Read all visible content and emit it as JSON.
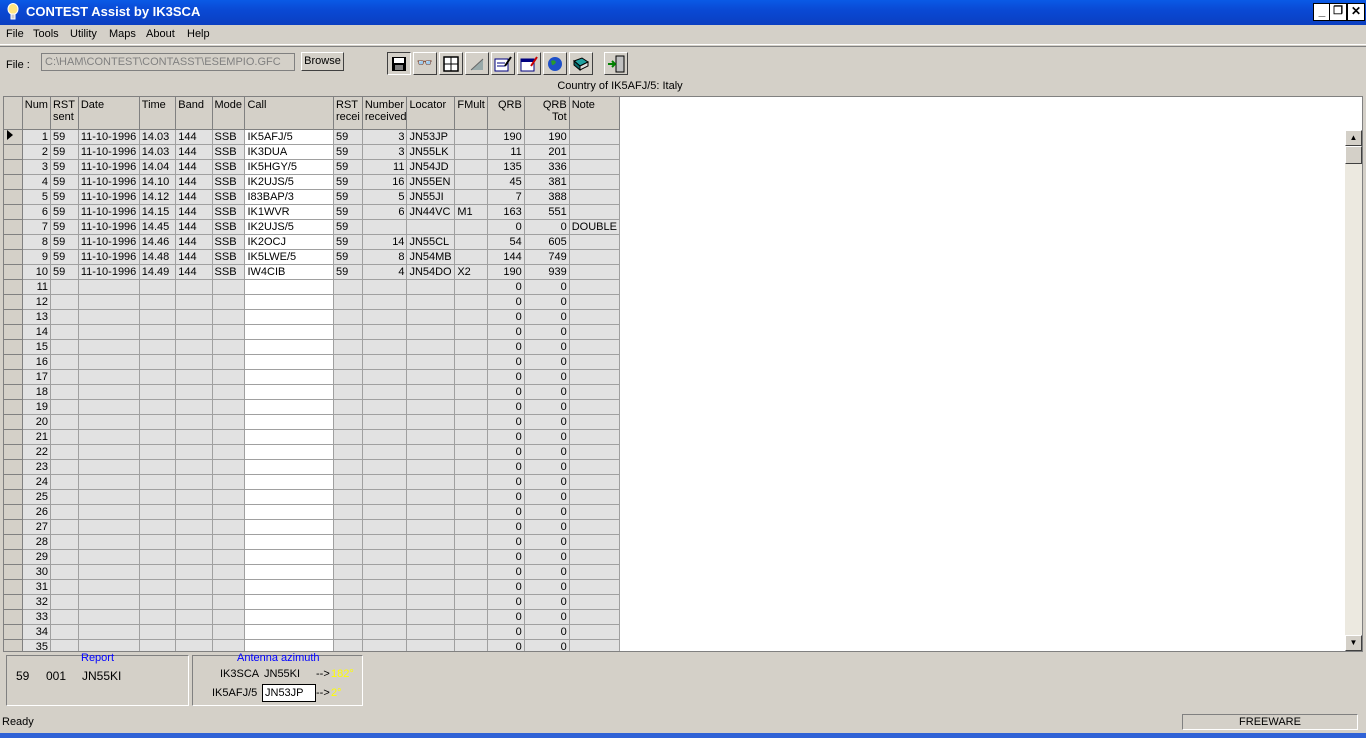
{
  "app": {
    "title": "CONTEST Assist by IK3SCA"
  },
  "menu": [
    "File",
    "Tools",
    "Utility",
    "Maps",
    "About",
    "Help"
  ],
  "toolbar": {
    "file_label": "File :",
    "file_path": "C:\\HAM\\CONTEST\\CONTASST\\ESEMPIO.GFC",
    "browse_label": "Browse",
    "icons": [
      "save-icon",
      "binoculars-icon",
      "grid-icon",
      "chart-icon",
      "edit-list-icon",
      "calendar-icon",
      "globe-icon",
      "book-icon",
      "exit-icon"
    ]
  },
  "country_text": "Country of IK5AFJ/5: Italy",
  "table": {
    "headers": [
      "Num",
      "RST sent",
      "Date",
      "Time",
      "Band",
      "Mode",
      "Call",
      "RST recei",
      "Number received",
      "Locator",
      "FMult",
      "QRB",
      "QRB Tot",
      "Note"
    ],
    "rows": [
      [
        "1",
        "59",
        "11-10-1996",
        "14.03",
        "144",
        "SSB",
        "IK5AFJ/5",
        "59",
        "3",
        "JN53JP",
        "",
        "190",
        "190",
        ""
      ],
      [
        "2",
        "59",
        "11-10-1996",
        "14.03",
        "144",
        "SSB",
        "IK3DUA",
        "59",
        "3",
        "JN55LK",
        "",
        "11",
        "201",
        ""
      ],
      [
        "3",
        "59",
        "11-10-1996",
        "14.04",
        "144",
        "SSB",
        "IK5HGY/5",
        "59",
        "11",
        "JN54JD",
        "",
        "135",
        "336",
        ""
      ],
      [
        "4",
        "59",
        "11-10-1996",
        "14.10",
        "144",
        "SSB",
        "IK2UJS/5",
        "59",
        "16",
        "JN55EN",
        "",
        "45",
        "381",
        ""
      ],
      [
        "5",
        "59",
        "11-10-1996",
        "14.12",
        "144",
        "SSB",
        "I83BAP/3",
        "59",
        "5",
        "JN55JI",
        "",
        "7",
        "388",
        ""
      ],
      [
        "6",
        "59",
        "11-10-1996",
        "14.15",
        "144",
        "SSB",
        "IK1WVR",
        "59",
        "6",
        "JN44VC",
        "M1",
        "163",
        "551",
        ""
      ],
      [
        "7",
        "59",
        "11-10-1996",
        "14.45",
        "144",
        "SSB",
        "IK2UJS/5",
        "59",
        "",
        "",
        "",
        "0",
        "0",
        "DOUBLE"
      ],
      [
        "8",
        "59",
        "11-10-1996",
        "14.46",
        "144",
        "SSB",
        "IK2OCJ",
        "59",
        "14",
        "JN55CL",
        "",
        "54",
        "605",
        ""
      ],
      [
        "9",
        "59",
        "11-10-1996",
        "14.48",
        "144",
        "SSB",
        "IK5LWE/5",
        "59",
        "8",
        "JN54MB",
        "",
        "144",
        "749",
        ""
      ],
      [
        "10",
        "59",
        "11-10-1996",
        "14.49",
        "144",
        "SSB",
        "IW4CIB",
        "59",
        "4",
        "JN54DO",
        "X2",
        "190",
        "939",
        ""
      ],
      [
        "11",
        "",
        "",
        "",
        "",
        "",
        "",
        "",
        "",
        "",
        "",
        "0",
        "0",
        ""
      ],
      [
        "12",
        "",
        "",
        "",
        "",
        "",
        "",
        "",
        "",
        "",
        "",
        "0",
        "0",
        ""
      ],
      [
        "13",
        "",
        "",
        "",
        "",
        "",
        "",
        "",
        "",
        "",
        "",
        "0",
        "0",
        ""
      ],
      [
        "14",
        "",
        "",
        "",
        "",
        "",
        "",
        "",
        "",
        "",
        "",
        "0",
        "0",
        ""
      ],
      [
        "15",
        "",
        "",
        "",
        "",
        "",
        "",
        "",
        "",
        "",
        "",
        "0",
        "0",
        ""
      ],
      [
        "16",
        "",
        "",
        "",
        "",
        "",
        "",
        "",
        "",
        "",
        "",
        "0",
        "0",
        ""
      ],
      [
        "17",
        "",
        "",
        "",
        "",
        "",
        "",
        "",
        "",
        "",
        "",
        "0",
        "0",
        ""
      ],
      [
        "18",
        "",
        "",
        "",
        "",
        "",
        "",
        "",
        "",
        "",
        "",
        "0",
        "0",
        ""
      ],
      [
        "19",
        "",
        "",
        "",
        "",
        "",
        "",
        "",
        "",
        "",
        "",
        "0",
        "0",
        ""
      ],
      [
        "20",
        "",
        "",
        "",
        "",
        "",
        "",
        "",
        "",
        "",
        "",
        "0",
        "0",
        ""
      ],
      [
        "21",
        "",
        "",
        "",
        "",
        "",
        "",
        "",
        "",
        "",
        "",
        "0",
        "0",
        ""
      ],
      [
        "22",
        "",
        "",
        "",
        "",
        "",
        "",
        "",
        "",
        "",
        "",
        "0",
        "0",
        ""
      ],
      [
        "23",
        "",
        "",
        "",
        "",
        "",
        "",
        "",
        "",
        "",
        "",
        "0",
        "0",
        ""
      ],
      [
        "24",
        "",
        "",
        "",
        "",
        "",
        "",
        "",
        "",
        "",
        "",
        "0",
        "0",
        ""
      ],
      [
        "25",
        "",
        "",
        "",
        "",
        "",
        "",
        "",
        "",
        "",
        "",
        "0",
        "0",
        ""
      ],
      [
        "26",
        "",
        "",
        "",
        "",
        "",
        "",
        "",
        "",
        "",
        "",
        "0",
        "0",
        ""
      ],
      [
        "27",
        "",
        "",
        "",
        "",
        "",
        "",
        "",
        "",
        "",
        "",
        "0",
        "0",
        ""
      ],
      [
        "28",
        "",
        "",
        "",
        "",
        "",
        "",
        "",
        "",
        "",
        "",
        "0",
        "0",
        ""
      ],
      [
        "29",
        "",
        "",
        "",
        "",
        "",
        "",
        "",
        "",
        "",
        "",
        "0",
        "0",
        ""
      ],
      [
        "30",
        "",
        "",
        "",
        "",
        "",
        "",
        "",
        "",
        "",
        "",
        "0",
        "0",
        ""
      ],
      [
        "31",
        "",
        "",
        "",
        "",
        "",
        "",
        "",
        "",
        "",
        "",
        "0",
        "0",
        ""
      ],
      [
        "32",
        "",
        "",
        "",
        "",
        "",
        "",
        "",
        "",
        "",
        "",
        "0",
        "0",
        ""
      ],
      [
        "33",
        "",
        "",
        "",
        "",
        "",
        "",
        "",
        "",
        "",
        "",
        "0",
        "0",
        ""
      ],
      [
        "34",
        "",
        "",
        "",
        "",
        "",
        "",
        "",
        "",
        "",
        "",
        "0",
        "0",
        ""
      ],
      [
        "35",
        "",
        "",
        "",
        "",
        "",
        "",
        "",
        "",
        "",
        "",
        "0",
        "0",
        ""
      ]
    ]
  },
  "report": {
    "label": "Report",
    "rst": "59",
    "number": "001",
    "locator": "JN55KI"
  },
  "antenna": {
    "label": "Antenna azimuth",
    "own_call": "IK3SCA",
    "own_locator": "JN55KI",
    "own_arrow": "-->",
    "own_azimuth": "182°",
    "dx_call": "IK5AFJ/5",
    "dx_locator": "JN53JP",
    "dx_arrow": "-->",
    "dx_azimuth": "2°"
  },
  "status": {
    "left": "Ready",
    "right": "FREEWARE"
  },
  "colors": {
    "title_bar": "#0a49d4",
    "azimuth": "#ffff00",
    "label_blue": "#0000ff"
  }
}
